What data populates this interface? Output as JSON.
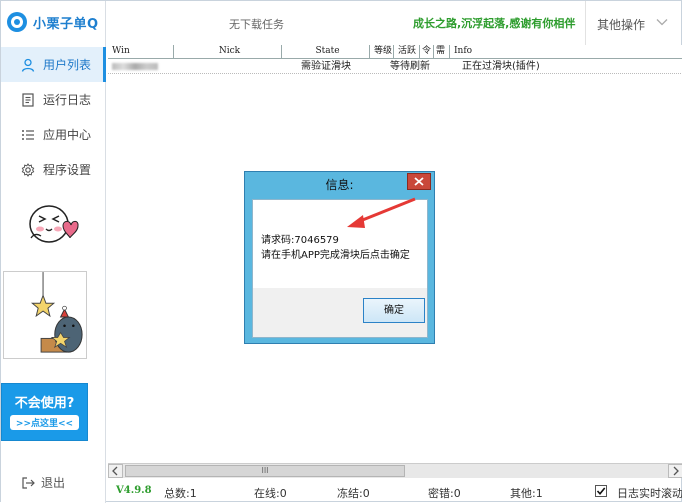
{
  "app": {
    "name": "小栗子单Q"
  },
  "nav": [
    {
      "label": "用户列表",
      "icon": "user-icon",
      "active": true
    },
    {
      "label": "运行日志",
      "icon": "log-icon"
    },
    {
      "label": "应用中心",
      "icon": "list-icon"
    },
    {
      "label": "程序设置",
      "icon": "gear-icon"
    }
  ],
  "help": {
    "title": "不会使用?",
    "link": ">>点这里<<"
  },
  "logout": {
    "label": "退出"
  },
  "header": {
    "task_status": "无下载任务",
    "slogan": "成长之路,沉浮起落,感谢有你相伴",
    "other_ops": "其他操作"
  },
  "table": {
    "columns": [
      "Win",
      "Nick",
      "State",
      "等级",
      "活跃",
      "令",
      "需",
      "Info"
    ],
    "rows": [
      {
        "win": "",
        "nick": "",
        "state": "需验证滑块",
        "level": "等待刷新",
        "info": "正在过滑块(插件)"
      }
    ]
  },
  "dialog": {
    "title": "信息:",
    "code_line": "请求码:7046579",
    "instruction": "请在手机APP完成滑块后点击确定",
    "ok_label": "确定"
  },
  "scrollbar": {
    "thumb_label": "III"
  },
  "status": {
    "version": "V4.9.8",
    "total": "总数:1",
    "online": "在线:0",
    "frozen": "冻结:0",
    "password_error": "密错:0",
    "other": "其他:1",
    "log_realtime_scroll": "日志实时滚动",
    "log_checked": true
  },
  "colors": {
    "accent": "#1e8fe1",
    "slogan": "#2e9d2e",
    "dialog_frame": "#5ab7df",
    "close": "#c9483a",
    "arrow": "#e53935"
  }
}
